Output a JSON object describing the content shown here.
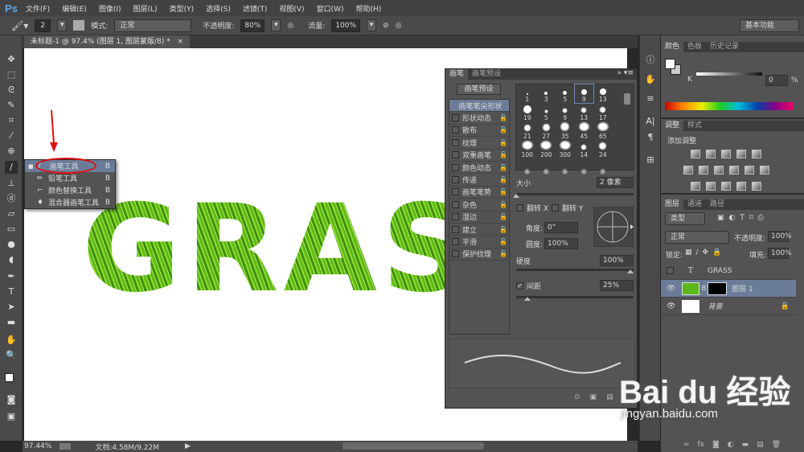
{
  "app": {
    "logo": "Ps"
  },
  "menu": [
    "文件(F)",
    "编辑(E)",
    "图像(I)",
    "图层(L)",
    "类型(Y)",
    "选择(S)",
    "滤镜(T)",
    "视图(V)",
    "窗口(W)",
    "帮助(H)"
  ],
  "options": {
    "brush_size": "2",
    "mode_label": "模式:",
    "mode_value": "正常",
    "opacity_label": "不透明度:",
    "opacity_value": "80%",
    "flow_label": "流量:",
    "flow_value": "100%",
    "workspace": "基本功能"
  },
  "document": {
    "tab_title": "未标题-1 @ 97.4% (图层 1, 图层蒙版/8) *",
    "close": "×",
    "canvas_text": "GRAS"
  },
  "tool_flyout": [
    {
      "label": "画笔工具",
      "key": "B",
      "selected": true
    },
    {
      "label": "铅笔工具",
      "key": "B"
    },
    {
      "label": "颜色替换工具",
      "key": "B"
    },
    {
      "label": "混合器画笔工具",
      "key": "B"
    }
  ],
  "status": {
    "zoom": "97.44%",
    "doc": "文档:4.58M/9.22M"
  },
  "brush_panel": {
    "tabs": [
      "画笔",
      "画笔预设"
    ],
    "preset_button": "画笔预设",
    "options": [
      {
        "label": "画笔笔尖形状",
        "active": true
      },
      {
        "label": "形状动态"
      },
      {
        "label": "散布"
      },
      {
        "label": "纹理"
      },
      {
        "label": "双重画笔"
      },
      {
        "label": "颜色动态"
      },
      {
        "label": "传递"
      },
      {
        "label": "画笔笔势"
      },
      {
        "label": "杂色"
      },
      {
        "label": "湿边"
      },
      {
        "label": "建立"
      },
      {
        "label": "平滑"
      },
      {
        "label": "保护纹理"
      }
    ],
    "tips": [
      "1",
      "3",
      "5",
      "9",
      "13",
      "19",
      "5",
      "9",
      "13",
      "17",
      "21",
      "27",
      "35",
      "45",
      "65",
      "100",
      "200",
      "300",
      "14",
      "24"
    ],
    "selected_tip": "9",
    "size_label": "大小",
    "size_value": "2 像素",
    "flip_x": "翻转 X",
    "flip_y": "翻转 Y",
    "angle_label": "角度:",
    "angle_value": "0°",
    "roundness_label": "圆度:",
    "roundness_value": "100%",
    "hardness_label": "硬度",
    "hardness_value": "100%",
    "spacing_label": "间距",
    "spacing_value": "25%",
    "spacing_checked": true,
    "size_fraction": 0.0,
    "hardness_fraction": 1.0,
    "spacing_fraction": 0.1
  },
  "color_panel": {
    "tabs": [
      "颜色",
      "色板",
      "历史记录"
    ],
    "channel": "K",
    "value": "0",
    "unit": "%"
  },
  "adjust_panel": {
    "tabs": [
      "调整",
      "样式"
    ],
    "title": "添加调整"
  },
  "layers_panel": {
    "tabs": [
      "图层",
      "通道",
      "路径"
    ],
    "filter": "类型",
    "blend": "正常",
    "opacity_label": "不透明度:",
    "opacity": "100%",
    "lock_label": "锁定:",
    "fill_label": "填充:",
    "fill": "100%",
    "layers": [
      {
        "name": "GRASS",
        "type": "text",
        "visible": false
      },
      {
        "name": "图层 1",
        "type": "masked",
        "visible": true,
        "selected": true
      },
      {
        "name": "背景",
        "type": "background",
        "visible": true,
        "locked": true
      }
    ]
  },
  "watermark": {
    "brand": "Bai du 经验",
    "url": "jingyan.baidu.com"
  }
}
